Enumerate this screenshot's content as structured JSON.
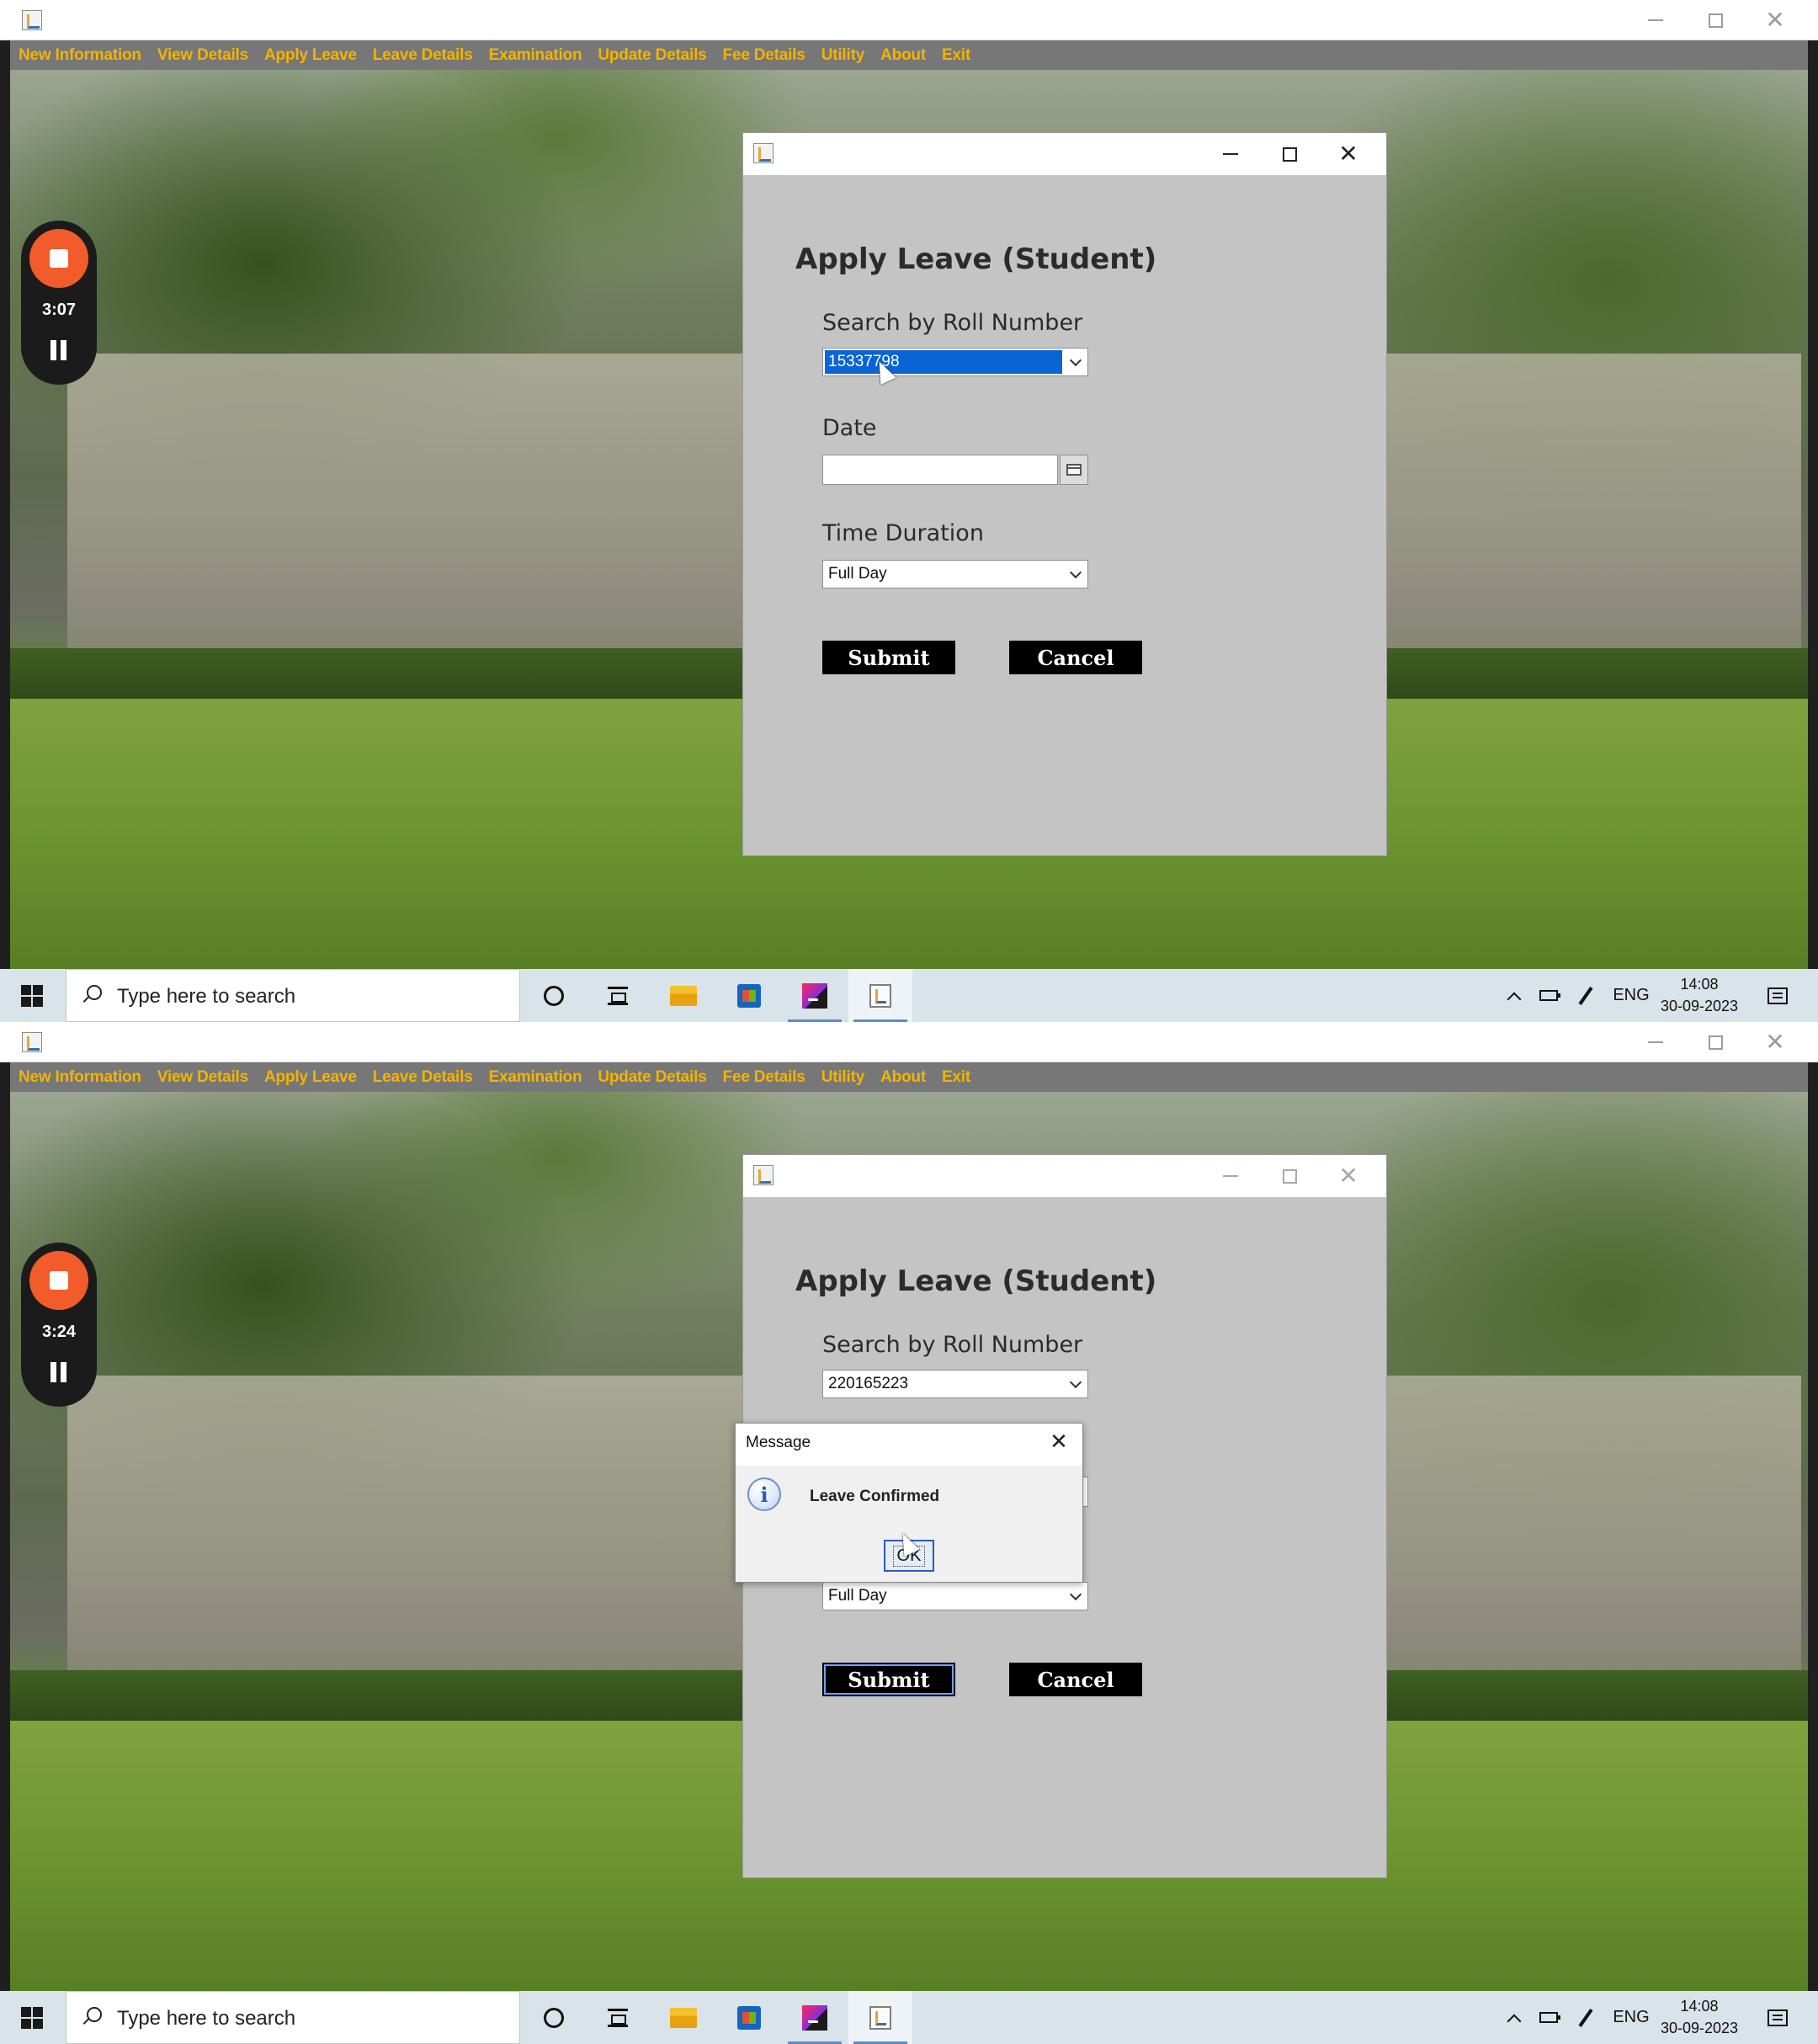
{
  "top_frame": {
    "menu": [
      "New Information",
      "View Details",
      "Apply Leave",
      "Leave Details",
      "Examination",
      "Update Details",
      "Fee Details",
      "Utility",
      "About",
      "Exit"
    ],
    "recorder_time": "3:07",
    "dialog": {
      "heading": "Apply Leave (Student)",
      "roll_label": "Search by Roll Number",
      "roll_value": "15337798",
      "date_label": "Date",
      "date_value": "",
      "duration_label": "Time Duration",
      "duration_value": "Full Day",
      "submit_label": "Submit",
      "cancel_label": "Cancel"
    }
  },
  "bottom_frame": {
    "menu": [
      "New Information",
      "View Details",
      "Apply Leave",
      "Leave Details",
      "Examination",
      "Update Details",
      "Fee Details",
      "Utility",
      "About",
      "Exit"
    ],
    "recorder_time": "3:24",
    "dialog": {
      "heading": "Apply Leave (Student)",
      "roll_label": "Search by Roll Number",
      "roll_value": "220165223",
      "duration_value": "Full Day",
      "submit_label": "Submit",
      "cancel_label": "Cancel"
    },
    "message_box": {
      "title": "Message",
      "text": "Leave Confirmed",
      "ok_label": "OK"
    }
  },
  "taskbar": {
    "search_placeholder": "Type here to search",
    "language": "ENG",
    "time": "14:08",
    "date": "30-09-2023"
  },
  "colors": {
    "menu_bar": "#777777",
    "menu_text": "#f3b400",
    "dialog_bg": "#c4c4c4",
    "selection": "#0a64d6",
    "button_bg": "#000000",
    "recorder_stop": "#f25c2b"
  }
}
